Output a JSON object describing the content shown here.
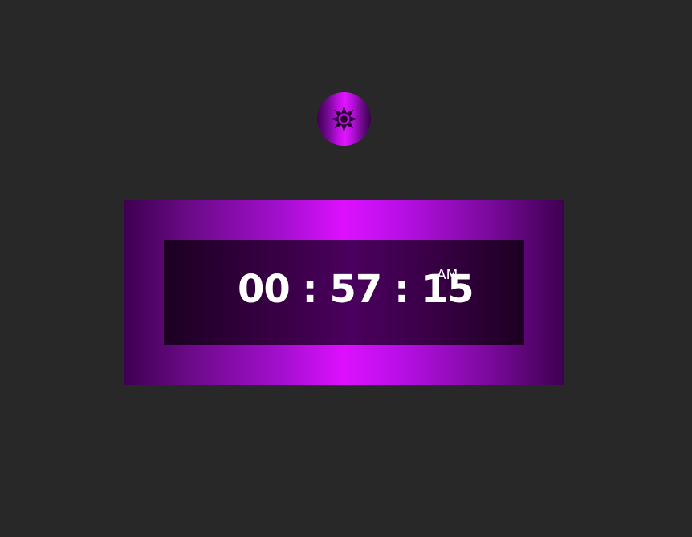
{
  "theme_toggle": {
    "icon": "sun-icon"
  },
  "clock": {
    "hours": "00",
    "minutes": "57",
    "seconds": "15",
    "separator": ":",
    "meridiem": "AM"
  },
  "colors": {
    "background": "#282828",
    "accent": "#dd10ff",
    "screen": "#3b0048",
    "text": "#ffffff"
  }
}
